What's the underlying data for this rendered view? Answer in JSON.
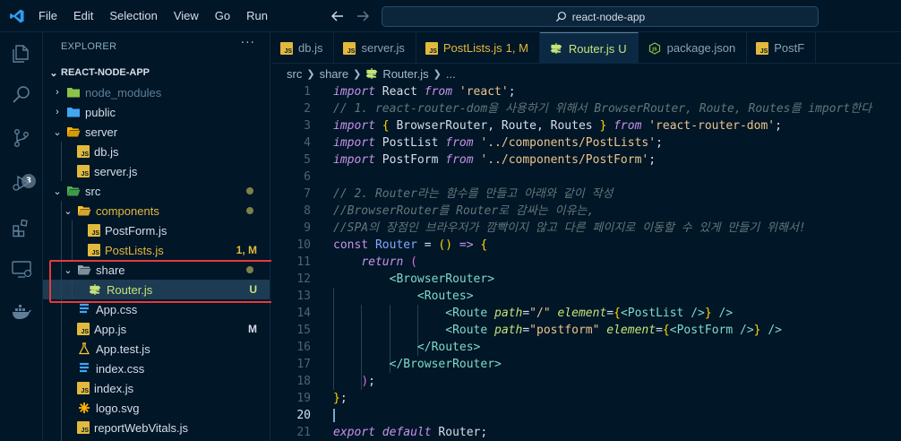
{
  "title_bar": {
    "menu": [
      "File",
      "Edit",
      "Selection",
      "View",
      "Go",
      "Run"
    ],
    "search": "react-node-app"
  },
  "activity_bar": {
    "items": [
      "explorer-icon",
      "search-icon",
      "source-control-icon",
      "run-debug-icon",
      "extensions-icon",
      "remote-explorer-icon",
      "docker-icon"
    ],
    "source_control_badge": "3"
  },
  "explorer": {
    "title": "EXPLORER",
    "more": "···",
    "root": "REACT-NODE-APP",
    "tree": [
      {
        "name": "node_modules",
        "type": "folder",
        "depth": 1,
        "open": false,
        "dim": true
      },
      {
        "name": "public",
        "type": "folder",
        "depth": 1,
        "open": false
      },
      {
        "name": "server",
        "type": "folder",
        "depth": 1,
        "open": true
      },
      {
        "name": "db.js",
        "type": "js",
        "depth": 2
      },
      {
        "name": "server.js",
        "type": "js",
        "depth": 2
      },
      {
        "name": "src",
        "type": "folder",
        "depth": 1,
        "open": true,
        "dot": true
      },
      {
        "name": "components",
        "type": "folder",
        "depth": 2,
        "open": true,
        "dot": true,
        "color": "#e2b93d"
      },
      {
        "name": "PostForm.js",
        "type": "js",
        "depth": 3
      },
      {
        "name": "PostLists.js",
        "type": "js",
        "depth": 3,
        "status": "1, M",
        "color": "#e2b93d"
      },
      {
        "name": "share",
        "type": "folder",
        "depth": 2,
        "open": true,
        "dot": true
      },
      {
        "name": "Router.js",
        "type": "router",
        "depth": 3,
        "status": "U",
        "color": "#c5e478"
      },
      {
        "name": "App.css",
        "type": "css",
        "depth": 2
      },
      {
        "name": "App.js",
        "type": "js",
        "depth": 2,
        "status": "M",
        "color": "#d6deeb"
      },
      {
        "name": "App.test.js",
        "type": "test",
        "depth": 2
      },
      {
        "name": "index.css",
        "type": "css",
        "depth": 2
      },
      {
        "name": "index.js",
        "type": "js",
        "depth": 2
      },
      {
        "name": "logo.svg",
        "type": "svg",
        "depth": 2
      },
      {
        "name": "reportWebVitals.js",
        "type": "js",
        "depth": 2
      }
    ]
  },
  "tabs": [
    {
      "label": "db.js",
      "icon": "js"
    },
    {
      "label": "server.js",
      "icon": "js"
    },
    {
      "label": "PostLists.js",
      "icon": "js",
      "status": "1, M"
    },
    {
      "label": "Router.js",
      "icon": "router",
      "status": "U",
      "active": true
    },
    {
      "label": "package.json",
      "icon": "json"
    },
    {
      "label": "PostF",
      "icon": "js"
    }
  ],
  "breadcrumb": [
    "src",
    "share",
    "Router.js",
    "..."
  ],
  "editor": {
    "line_numbers": [
      "1",
      "2",
      "3",
      "4",
      "5",
      "6",
      "7",
      "8",
      "9",
      "10",
      "11",
      "12",
      "13",
      "14",
      "15",
      "16",
      "17",
      "18",
      "19",
      "20",
      "21"
    ],
    "current_line": "20"
  },
  "colors": {
    "background": "#011627",
    "selection": "#1d3b53",
    "highlight_box": "#e33b3b",
    "modified": "#e2b93d",
    "untracked": "#c5e478"
  }
}
